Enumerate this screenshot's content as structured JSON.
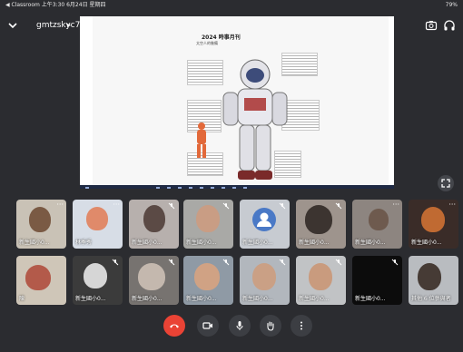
{
  "status_bar": {
    "left": "◀ Classroom  上午3:30  6月24日 星期四",
    "right": "79%"
  },
  "header": {
    "meeting_code": "gmtzskyc7",
    "caret": "▸",
    "recording_badge": "錄製"
  },
  "presentation": {
    "title": "2024 時事月刊",
    "subtitle": "太空人的裝備"
  },
  "participants_row1": [
    {
      "name": "新生國小0..."
    },
    {
      "name": "林季秀"
    },
    {
      "name": "新生國小0..."
    },
    {
      "name": "新生國小0..."
    },
    {
      "name": "新生國小0..."
    },
    {
      "name": "新生國小0..."
    },
    {
      "name": "新生國小0..."
    },
    {
      "name": "新生國小0..."
    }
  ],
  "participants_row2": [
    {
      "name": "陳"
    },
    {
      "name": "新生國小0..."
    },
    {
      "name": "新生國小0..."
    },
    {
      "name": "新生國小0..."
    },
    {
      "name": "新生國小0..."
    },
    {
      "name": "新生國小0..."
    },
    {
      "name": "新生國小0..."
    },
    {
      "name": "其他 6 位參與者"
    }
  ],
  "colors": {
    "background": "#2b2c30",
    "end_call": "#ea4335",
    "recording": "#d93025",
    "avatar_blue": "#4a79c6"
  },
  "icons": [
    "chevron-down-icon",
    "camera-switch-icon",
    "headphones-icon",
    "fullscreen-icon",
    "more-icon",
    "mic-off-icon",
    "end-call-icon",
    "video-icon",
    "mic-icon",
    "raise-hand-icon",
    "more-vert-icon"
  ]
}
